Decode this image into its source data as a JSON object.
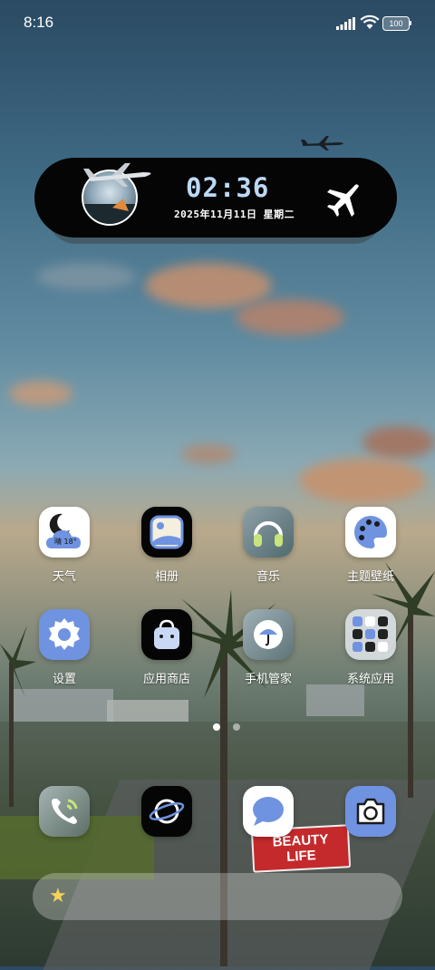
{
  "status_bar": {
    "time": "8:16",
    "battery": "100"
  },
  "widget": {
    "time": "02:36",
    "date": "2025年11月11日 星期二"
  },
  "apps_row1": [
    {
      "label": "天气",
      "icon": "weather-icon",
      "temp": "晴 18°"
    },
    {
      "label": "相册",
      "icon": "gallery-icon"
    },
    {
      "label": "音乐",
      "icon": "music-icon"
    },
    {
      "label": "主题壁纸",
      "icon": "theme-icon"
    }
  ],
  "apps_row2": [
    {
      "label": "设置",
      "icon": "settings-icon"
    },
    {
      "label": "应用商店",
      "icon": "app-store-icon"
    },
    {
      "label": "手机管家",
      "icon": "phone-manager-icon"
    },
    {
      "label": "系统应用",
      "icon": "folder-icon"
    }
  ],
  "dock_apps": [
    {
      "icon": "phone-icon"
    },
    {
      "icon": "browser-icon"
    },
    {
      "icon": "messages-icon"
    },
    {
      "icon": "camera-icon"
    }
  ],
  "scene_sign": {
    "line1": "BEAUTY",
    "line2": "LIFE"
  },
  "colors": {
    "accent_blue": "#6f93e0",
    "clock_text": "#bcd9f5"
  }
}
